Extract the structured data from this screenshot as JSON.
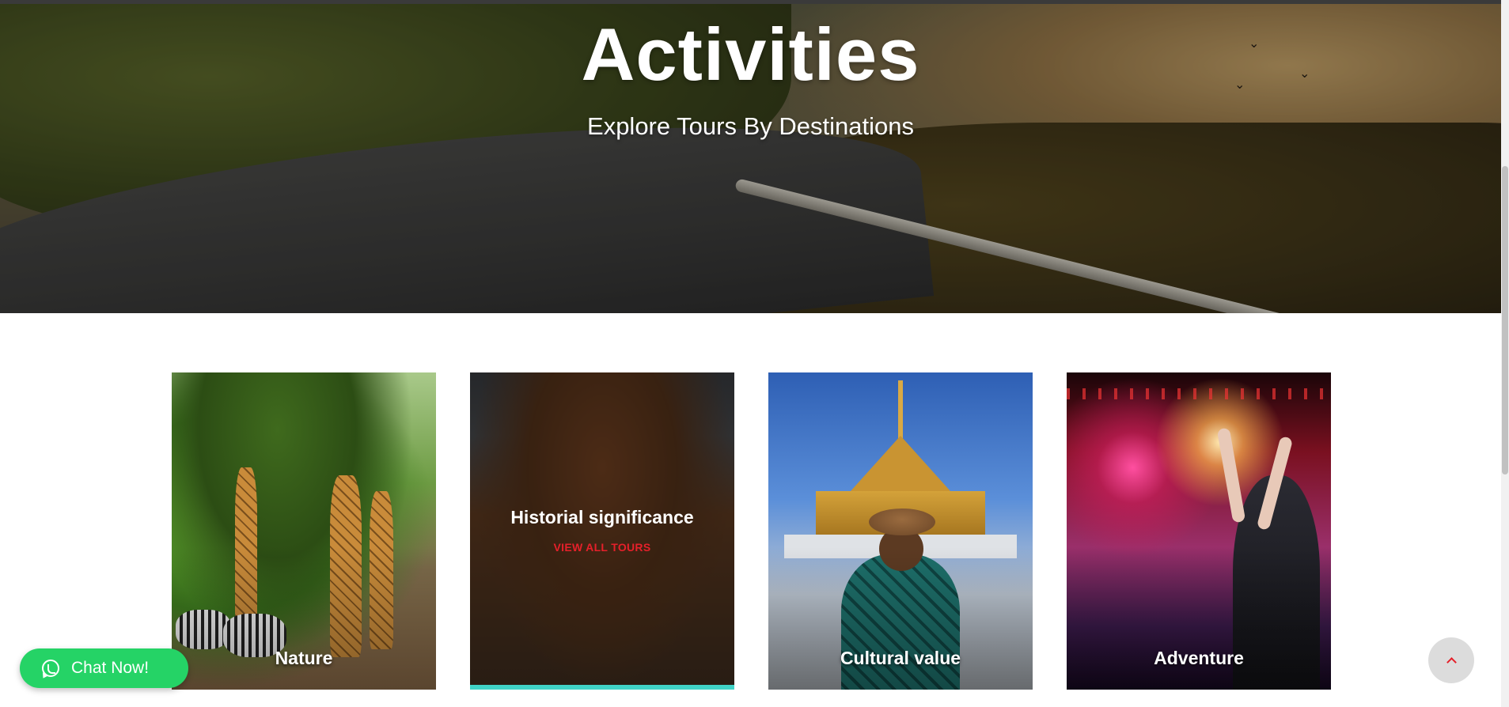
{
  "hero": {
    "title": "Activities",
    "subtitle": "Explore Tours By Destinations"
  },
  "cards": [
    {
      "label": "Nature",
      "image": "giraffes-and-zebras-photo"
    },
    {
      "label": "Historial significance",
      "link": "VIEW ALL TOURS",
      "image": "canyon-rocks-photo",
      "active": true
    },
    {
      "label": "Cultural value",
      "image": "thai-temple-woman-photo"
    },
    {
      "label": "Adventure",
      "image": "concert-performer-photo"
    }
  ],
  "chat": {
    "label": "Chat Now!",
    "icon": "whatsapp-icon"
  },
  "scroll_top": {
    "icon": "chevron-up-icon"
  },
  "colors": {
    "accent_link": "#e5202a",
    "active_underline": "#40d3c6",
    "chat_button": "#25d366"
  }
}
